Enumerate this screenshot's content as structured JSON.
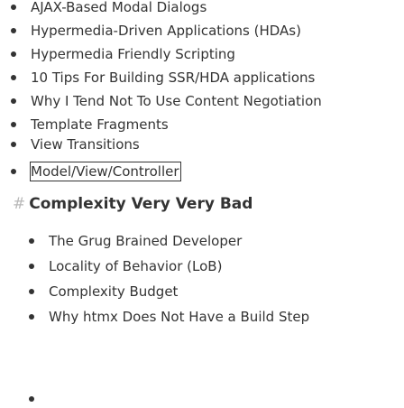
{
  "list1": [
    {
      "label": "AJAX-Based Modal Dialogs"
    },
    {
      "label": "Hypermedia-Driven Applications (HDAs)"
    },
    {
      "label": "Hypermedia Friendly Scripting"
    },
    {
      "label": "10 Tips For Building SSR/HDA applications"
    },
    {
      "label": "Why I Tend Not To Use Content Negotiation"
    },
    {
      "label": "Template Fragments"
    },
    {
      "label": "View Transitions"
    },
    {
      "label": "Model/View/Controller"
    }
  ],
  "section": {
    "hash": "#",
    "title": "Complexity Very Very Bad"
  },
  "list2": [
    {
      "label": "The Grug Brained Developer"
    },
    {
      "label": "Locality of Behavior (LoB)"
    },
    {
      "label": "Complexity Budget"
    },
    {
      "label": "Why htmx Does Not Have a Build Step"
    },
    {
      "label": ""
    }
  ],
  "colors": {
    "text": "#333333",
    "hash": "#b8b8b8",
    "background": "#ffffff"
  }
}
